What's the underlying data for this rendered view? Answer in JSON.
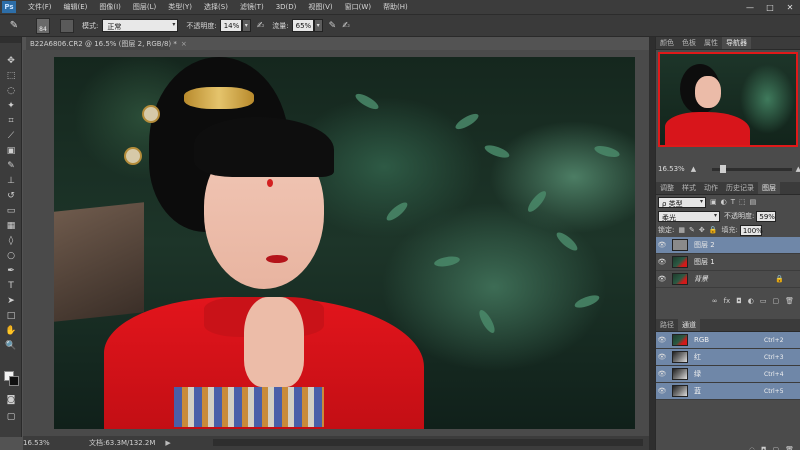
{
  "app": {
    "logo": "Ps"
  },
  "menu": [
    "文件(F)",
    "编辑(E)",
    "图像(I)",
    "图层(L)",
    "类型(Y)",
    "选择(S)",
    "滤镜(T)",
    "3D(D)",
    "视图(V)",
    "窗口(W)",
    "帮助(H)"
  ],
  "window_controls": [
    "—",
    "□",
    "✕"
  ],
  "options": {
    "brush_size": "84",
    "mode_label": "模式:",
    "mode_value": "正常",
    "opacity_label": "不透明度:",
    "opacity_value": "14%",
    "flow_label": "流量:",
    "flow_value": "65%"
  },
  "document_tab": {
    "title": "B22A6806.CR2 @ 16.5% (图层 2, RGB/8) *",
    "close": "×"
  },
  "status": {
    "zoom": "16.53%",
    "doc_size": "文档:63.3M/132.2M",
    "arrow": "▶"
  },
  "navigator": {
    "tabs": [
      "颜色",
      "色板",
      "属性",
      "导航器"
    ],
    "active_tab": "导航器",
    "zoom": "16.53%"
  },
  "layers_panel": {
    "tabs": [
      "调整",
      "样式",
      "动作",
      "历史记录",
      "图层"
    ],
    "active_tab": "图层",
    "filter_kind": "ρ 类型",
    "blend_mode": "柔光",
    "opacity_label": "不透明度:",
    "opacity_value": "59%",
    "lock_label": "锁定:",
    "fill_label": "填充:",
    "fill_value": "100%",
    "layers": [
      {
        "name": "图层 2",
        "selected": true,
        "thumb": "gray"
      },
      {
        "name": "图层 1",
        "selected": false,
        "thumb": "photo"
      },
      {
        "name": "背景",
        "selected": false,
        "thumb": "photo",
        "locked": true
      }
    ]
  },
  "channels_panel": {
    "tabs": [
      "路径",
      "通道"
    ],
    "active_tab": "通道",
    "channels": [
      {
        "name": "RGB",
        "shortcut": "Ctrl+2"
      },
      {
        "name": "红",
        "shortcut": "Ctrl+3"
      },
      {
        "name": "绿",
        "shortcut": "Ctrl+4"
      },
      {
        "name": "蓝",
        "shortcut": "Ctrl+5"
      }
    ]
  },
  "colors": {
    "selected_row": "#6f87a8",
    "nav_frame": "#e01919",
    "ps_blue": "#2d6ea8"
  }
}
